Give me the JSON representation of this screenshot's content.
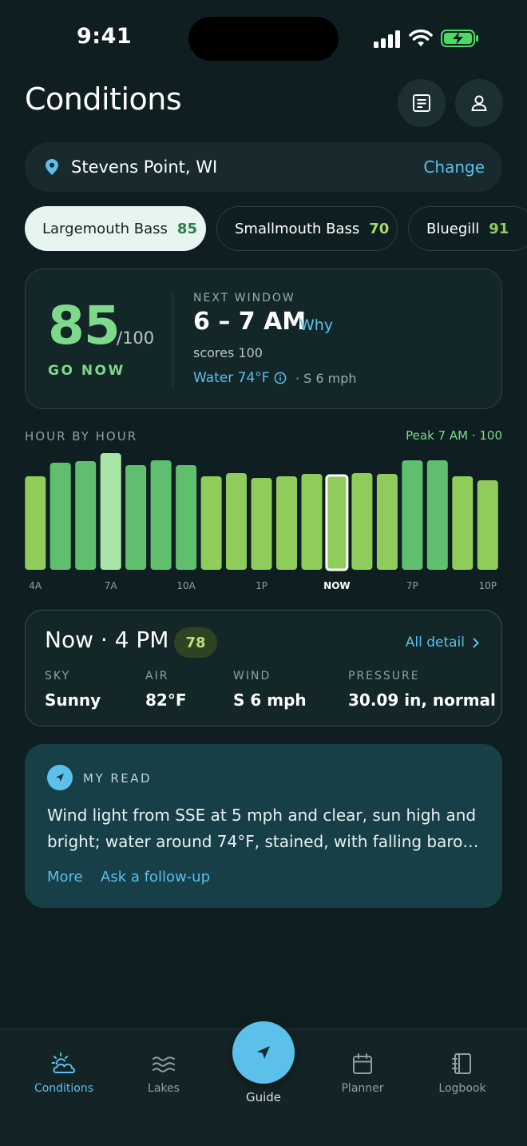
{
  "status_bar": {
    "time": "9:41"
  },
  "header": {
    "title": "Conditions"
  },
  "location": {
    "name": "Stevens Point, WI",
    "change_label": "Change"
  },
  "species_chips": [
    {
      "name": "Largemouth Bass",
      "score": "85",
      "selected": true
    },
    {
      "name": "Smallmouth Bass",
      "score": "70",
      "selected": false
    },
    {
      "name": "Bluegill",
      "score": "91",
      "selected": false
    }
  ],
  "score_card": {
    "score": "85",
    "denominator": "/100",
    "verdict": "GO NOW",
    "next_window_caption": "NEXT WINDOW",
    "next_window_time": "6 – 7 AM",
    "why_label": "Why",
    "scores_text": "scores 100",
    "water": "Water 74°F",
    "wind": "· S 6 mph"
  },
  "hour_by_hour": {
    "caption": "HOUR BY HOUR",
    "peak": "Peak 7 AM · 100"
  },
  "chart_data": {
    "type": "bar",
    "categories": [
      "4A",
      "5A",
      "6A",
      "7A",
      "8A",
      "9A",
      "10A",
      "11A",
      "12P",
      "1P",
      "2P",
      "3P",
      "NOW",
      "5P",
      "6P",
      "7P",
      "8P",
      "9P",
      "10P"
    ],
    "values": [
      80,
      92,
      93,
      100,
      90,
      94,
      90,
      80,
      83,
      79,
      80,
      82,
      81,
      83,
      82,
      94,
      94,
      80,
      77
    ],
    "tick_labels": [
      {
        "label": "4A",
        "index": 0
      },
      {
        "label": "7A",
        "index": 3
      },
      {
        "label": "10A",
        "index": 6
      },
      {
        "label": "1P",
        "index": 9
      },
      {
        "label": "NOW",
        "index": 12
      },
      {
        "label": "7P",
        "index": 15
      },
      {
        "label": "10P",
        "index": 18
      }
    ],
    "highlight_index": 12,
    "peak_index": 3,
    "ylim": [
      0,
      100
    ],
    "colors": {
      "high": "#5fbf6f",
      "mid": "#8fcc5c",
      "peak": "#a8e6a8"
    }
  },
  "now_card": {
    "title": "Now · 4 PM",
    "badge": "78",
    "all_detail": "All detail",
    "metrics": [
      {
        "label": "SKY",
        "value": "Sunny"
      },
      {
        "label": "AIR",
        "value": "82°F"
      },
      {
        "label": "WIND",
        "value": "S 6 mph"
      },
      {
        "label": "PRESSURE",
        "value": "30.09 in, normal"
      }
    ]
  },
  "my_read": {
    "caption": "MY READ",
    "body": "Wind light from SSE at 5 mph and clear, sun high and bright; water around 74°F, stained, with falling baro…",
    "more_label": "More",
    "followup_label": "Ask a follow-up"
  },
  "tab_bar": {
    "tabs": [
      {
        "label": "Conditions",
        "active": true
      },
      {
        "label": "Lakes",
        "active": false
      },
      {
        "label": "Guide",
        "active": false
      },
      {
        "label": "Planner",
        "active": false
      },
      {
        "label": "Logbook",
        "active": false
      }
    ]
  }
}
